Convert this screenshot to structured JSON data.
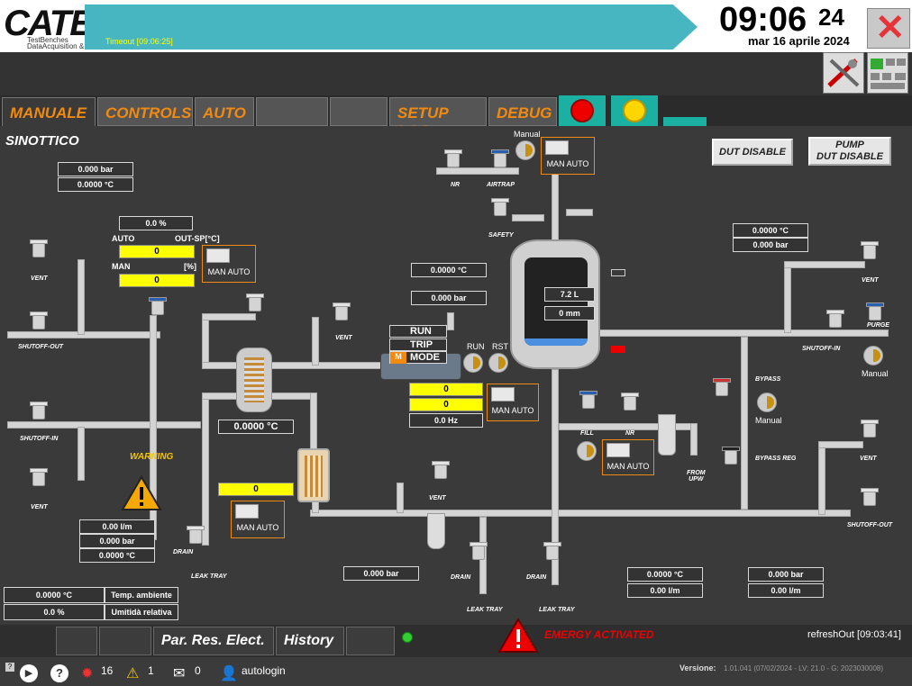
{
  "header": {
    "logo": "CATE",
    "logo_sub1": "TestBenches",
    "logo_sub2": "DataAcquisition",
    "logo_amp": "&",
    "timeout": "Timeout [09:06:25]",
    "clock": "09:06",
    "seconds": "24",
    "date": "mar 16 aprile 2024",
    "close": "✕"
  },
  "tabs": [
    {
      "label": "MANUALE"
    },
    {
      "label": "CONTROLS"
    },
    {
      "label": "AUTO"
    },
    {
      "label": ""
    },
    {
      "label": ""
    },
    {
      "label": "SETUP LOG"
    },
    {
      "label": "DEBUG"
    }
  ],
  "panel": {
    "title": "SINOTTICO"
  },
  "buttons": {
    "dut_disable": "DUT DISABLE",
    "pump_dut_disable": "PUMP\nDUT DISABLE"
  },
  "readouts": {
    "top_left_bar": "0.000 bar",
    "top_left_temp": "0.0000 °C",
    "pct": "0.0 %",
    "auto": "AUTO",
    "out_sp": "OUT-SP[°C]",
    "man": "MAN",
    "pct_unit": "[%]",
    "yellow1": "0",
    "yellow2": "0",
    "tank_temp": "0.0000 °C",
    "tank_bar": "0.000 bar",
    "tank_level": "7.2 L",
    "tank_mm": "0 mm",
    "right_temp": "0.0000 °C",
    "right_bar": "0.000 bar",
    "hx_temp": "0.0000 °C",
    "heater_val": "0",
    "pump_y1": "0",
    "pump_y2": "0",
    "pump_hz": "0.0 Hz",
    "left_flow": "0.00 l/m",
    "left_bar": "0.000 bar",
    "left_temp": "0.0000 °C",
    "amb_temp": "0.0000 °C",
    "amb_label": "Temp. ambiente",
    "hum": "0.0 %",
    "hum_label": "Umitidà relativa",
    "mid_bar": "0.000 bar",
    "out_temp": "0.0000 °C",
    "out_flow": "0.00 l/m",
    "out_bar": "0.000 bar",
    "out_flow2": "0.00 l/m"
  },
  "pump": {
    "run": "RUN",
    "trip": "TRIP",
    "mode": "MODE",
    "m": "M",
    "run_lbl": "RUN",
    "rst_lbl": "RST"
  },
  "labels": {
    "manual": "Manual",
    "man": "MAN",
    "auto": "AUTO",
    "vent": "VENT",
    "shutoff_out": "SHUTOFF-OUT",
    "shutoff_in": "SHUTOFF-IN",
    "nr": "NR",
    "airtrap": "AIRTRAP",
    "safety": "SAFETY",
    "purge": "PURGE",
    "bypass": "BYPASS",
    "bypass_reg": "BYPASS REG",
    "fill": "FILL",
    "from_upw": "FROM\nUPW",
    "drain": "DRAIN",
    "leak_tray": "LEAK TRAY",
    "warning": "WARNING"
  },
  "bottom": {
    "par_res": "Par. Res. Elect.",
    "history": "History",
    "emergy": "EMERGY ACTIVATED",
    "refresh": "refreshOut [09:03:41]"
  },
  "status": {
    "alarms": "16",
    "warnings": "1",
    "messages": "0",
    "user": "autologin",
    "version_label": "Versione:",
    "version": "1.01.041 (07/02/2024 - LV: 21.0 - G: 2023030008)"
  }
}
